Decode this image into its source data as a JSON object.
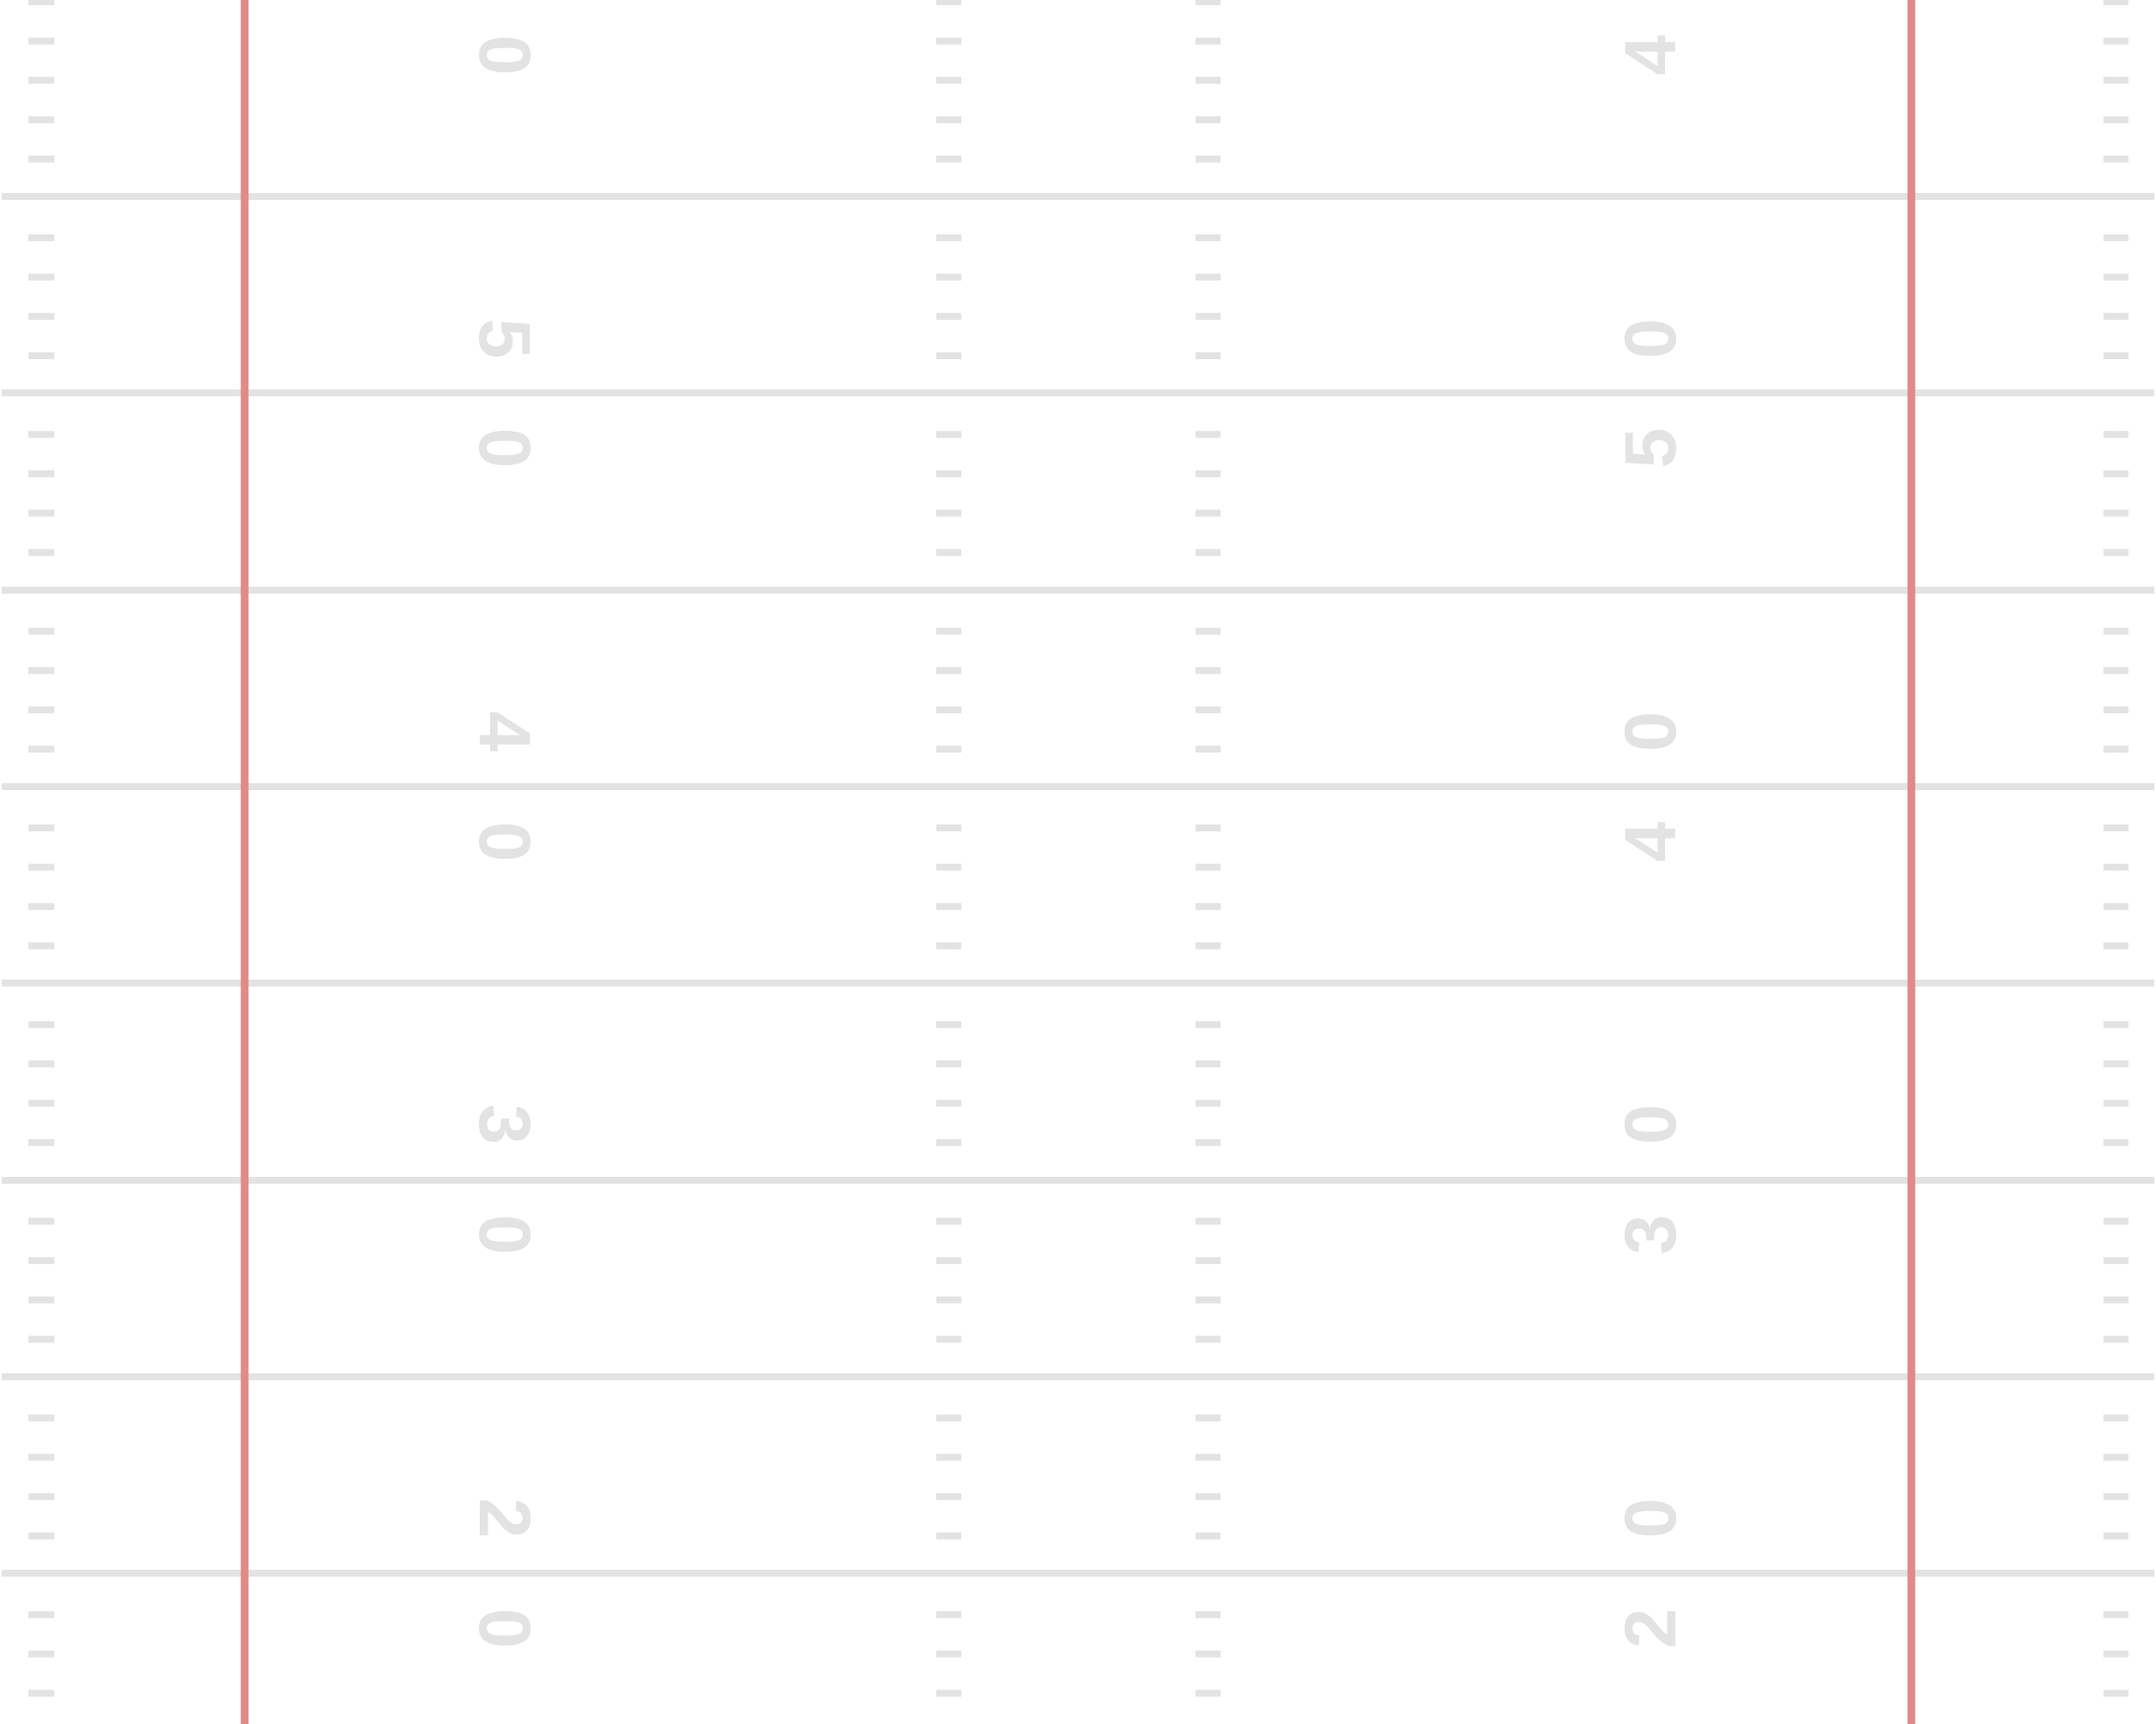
{
  "field": {
    "colors": {
      "background": "#ffffff",
      "yard_line": "#e3e3e3",
      "hash_mark": "#e3e3e3",
      "sideline": "#e08a8a",
      "numbers": "#e3e3e3"
    },
    "number_digits": [
      {
        "left": "0",
        "right": "4"
      },
      {
        "left": "5",
        "right": "0"
      },
      {
        "left": "0",
        "right": "5"
      },
      {
        "left": "4",
        "right": "0"
      },
      {
        "left": "0",
        "right": "4"
      },
      {
        "left": "3",
        "right": "0"
      },
      {
        "left": "0",
        "right": "3"
      },
      {
        "left": "2",
        "right": "0"
      },
      {
        "left": "0",
        "right": "2"
      }
    ]
  }
}
